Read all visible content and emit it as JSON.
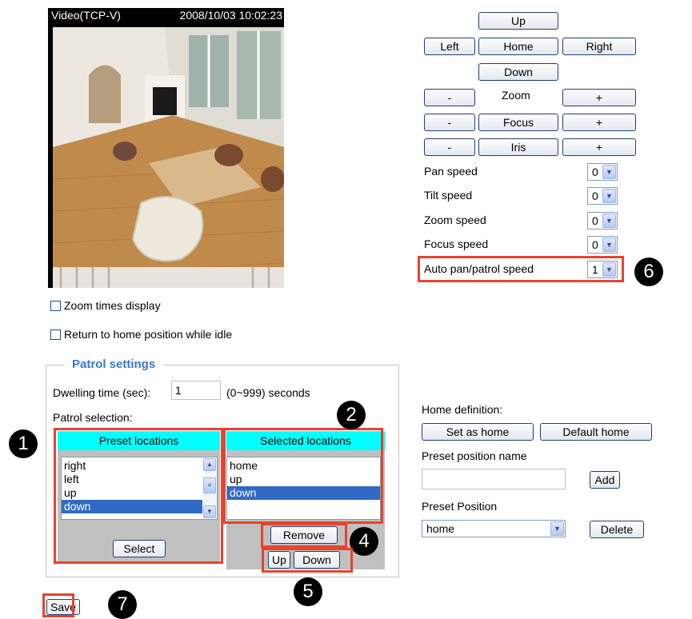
{
  "video": {
    "title": "Video(TCP-V)",
    "timestamp": "2008/10/03 10:02:23"
  },
  "ptz": {
    "up": "Up",
    "left": "Left",
    "home": "Home",
    "right": "Right",
    "down": "Down",
    "minus": "-",
    "plus": "+",
    "zoom": "Zoom",
    "focus": "Focus",
    "iris": "Iris"
  },
  "speeds": [
    {
      "label": "Pan speed",
      "value": "0"
    },
    {
      "label": "Tilt speed",
      "value": "0"
    },
    {
      "label": "Zoom speed",
      "value": "0"
    },
    {
      "label": "Focus speed",
      "value": "0"
    },
    {
      "label": "Auto pan/patrol speed",
      "value": "1"
    }
  ],
  "options": {
    "zoom_times_display": "Zoom times display",
    "return_home_idle": "Return to home position while idle"
  },
  "patrol": {
    "legend": "Patrol settings",
    "dwelling_label": "Dwelling time (sec):",
    "dwelling_value": "1",
    "dwelling_range": "(0~999) seconds",
    "selection_label": "Patrol selection:",
    "preset_header": "Preset locations",
    "selected_header": "Selected locations",
    "preset_items": [
      "right",
      "left",
      "up",
      "down"
    ],
    "selected_items": [
      "home",
      "up",
      "down"
    ],
    "select_btn": "Select",
    "remove_btn": "Remove",
    "up_btn": "Up",
    "down_btn": "Down"
  },
  "home_def": {
    "label": "Home definition:",
    "set_as_home": "Set as home",
    "default_home": "Default home",
    "preset_name_label": "Preset position name",
    "add_btn": "Add",
    "preset_position_label": "Preset Position",
    "preset_position_value": "home",
    "delete_btn": "Delete"
  },
  "save_btn": "Save",
  "badges": [
    "1",
    "2",
    "4",
    "5",
    "6",
    "7"
  ],
  "colors": {
    "accent_blue": "#3a78c4",
    "header_cyan": "#00ffff",
    "annotation_red": "#e8432c",
    "panel_gray": "#c0c0c0"
  }
}
